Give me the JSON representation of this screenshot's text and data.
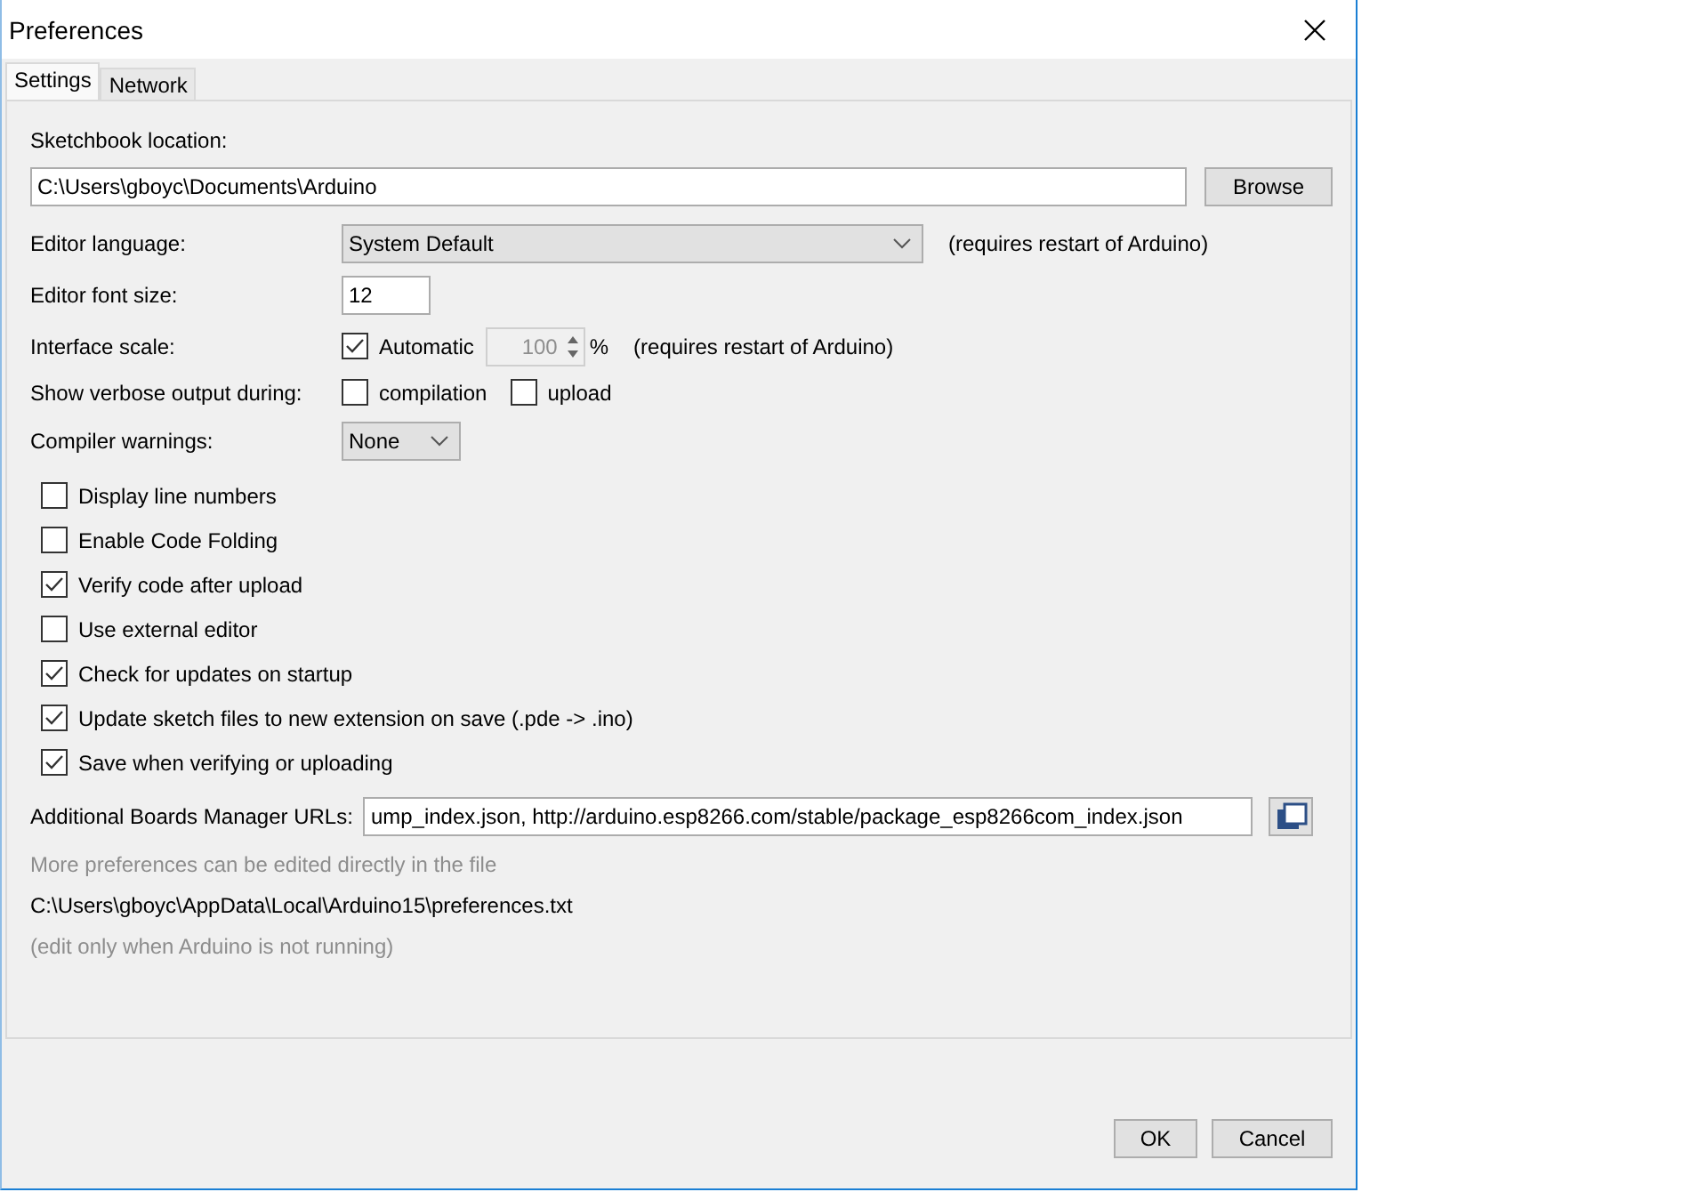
{
  "window": {
    "title": "Preferences"
  },
  "tabs": [
    {
      "label": "Settings",
      "selected": true
    },
    {
      "label": "Network",
      "selected": false
    }
  ],
  "sketchbook": {
    "label": "Sketchbook location:",
    "value": "C:\\Users\\gboyc\\Documents\\Arduino",
    "button": "Browse"
  },
  "editor_language": {
    "label": "Editor language:",
    "value": "System Default",
    "note": "(requires restart of Arduino)"
  },
  "editor_font_size": {
    "label": "Editor font size:",
    "value": "12"
  },
  "interface_scale": {
    "label": "Interface scale:",
    "automatic": {
      "label": "Automatic",
      "checked": true
    },
    "value": "100",
    "disabled": true,
    "unit": "%",
    "note": "(requires restart of Arduino)"
  },
  "verbose_output": {
    "label": "Show verbose output during:",
    "options": [
      {
        "label": "compilation",
        "checked": false
      },
      {
        "label": "upload",
        "checked": false
      }
    ]
  },
  "compiler_warnings": {
    "label": "Compiler warnings:",
    "value": "None"
  },
  "options": [
    {
      "label": "Display line numbers",
      "checked": false
    },
    {
      "label": "Enable Code Folding",
      "checked": false
    },
    {
      "label": "Verify code after upload",
      "checked": true
    },
    {
      "label": "Use external editor",
      "checked": false
    },
    {
      "label": "Check for updates on startup",
      "checked": true
    },
    {
      "label": "Update sketch files to new extension on save (.pde -> .ino)",
      "checked": true
    },
    {
      "label": "Save when verifying or uploading",
      "checked": true
    }
  ],
  "boards_manager_urls": {
    "label": "Additional Boards Manager URLs:",
    "value": "ump_index.json, http://arduino.esp8266.com/stable/package_esp8266com_index.json"
  },
  "info": {
    "hint": "More preferences can be edited directly in the file",
    "path": "C:\\Users\\gboyc\\AppData\\Local\\Arduino15\\preferences.txt",
    "note": "(edit only when Arduino is not running)"
  },
  "buttons": [
    "OK",
    "Cancel"
  ]
}
